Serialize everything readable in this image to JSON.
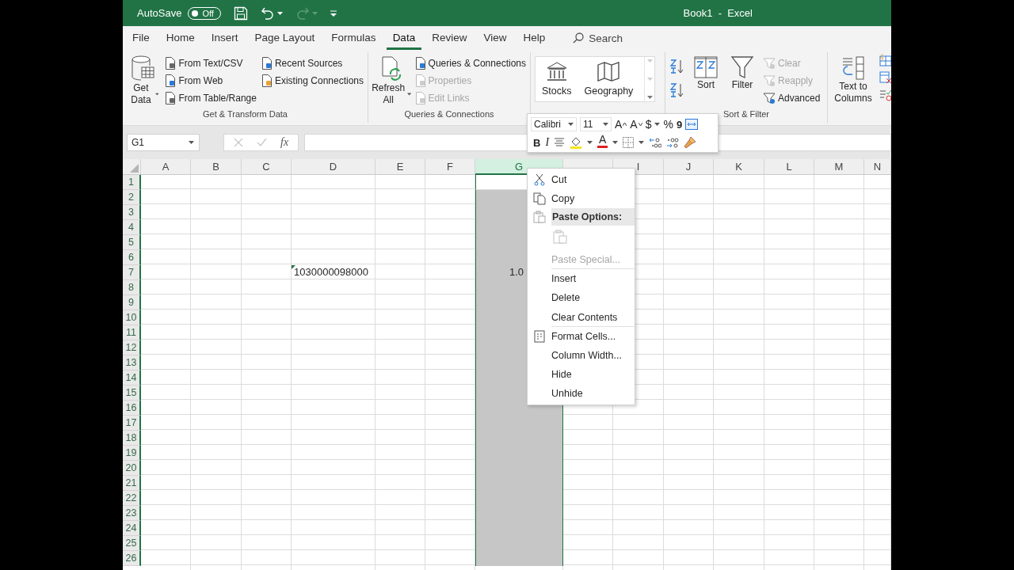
{
  "title_bar": {
    "autosave_label": "AutoSave",
    "autosave": {
      "on": false,
      "label": "Off"
    },
    "title": "Book1  -  Excel"
  },
  "menu_tabs": [
    {
      "label": "File",
      "selected": false
    },
    {
      "label": "Home",
      "selected": false
    },
    {
      "label": "Insert",
      "selected": false
    },
    {
      "label": "Page Layout",
      "selected": false
    },
    {
      "label": "Formulas",
      "selected": false
    },
    {
      "label": "Data",
      "selected": true
    },
    {
      "label": "Review",
      "selected": false
    },
    {
      "label": "View",
      "selected": false
    },
    {
      "label": "Help",
      "selected": false
    }
  ],
  "search": {
    "placeholder": "Search"
  },
  "ribbon": {
    "groups": [
      {
        "kind": "get-transform",
        "label": "Get & Transform Data",
        "large": [
          {
            "label": "Get Data",
            "disabled": false
          }
        ],
        "items": [
          {
            "label": "From Text/CSV",
            "disabled": false
          },
          {
            "label": "From Web",
            "disabled": false
          },
          {
            "label": "From Table/Range",
            "disabled": false
          },
          {
            "label": "Recent Sources",
            "disabled": false
          },
          {
            "label": "Existing Connections",
            "disabled": false
          }
        ]
      },
      {
        "kind": "queries",
        "label": "Queries & Connections",
        "large": [
          {
            "label": "Refresh All",
            "disabled": false
          }
        ],
        "items": [
          {
            "label": "Queries & Connections",
            "disabled": false
          },
          {
            "label": "Properties",
            "disabled": true
          },
          {
            "label": "Edit Links",
            "disabled": true
          }
        ]
      },
      {
        "kind": "data-types",
        "large": [
          {
            "label": "Stocks",
            "disabled": false
          },
          {
            "label": "Geography",
            "disabled": false
          }
        ]
      },
      {
        "kind": "sort-filter",
        "label": "Sort & Filter",
        "large": [
          {
            "label": "Sort",
            "disabled": false
          },
          {
            "label": "Filter",
            "disabled": false
          }
        ],
        "items": [
          {
            "label": "Clear",
            "disabled": true
          },
          {
            "label": "Reapply",
            "disabled": true
          },
          {
            "label": "Advanced",
            "disabled": false
          }
        ]
      },
      {
        "kind": "data-tools",
        "large": [
          {
            "label": "Text to Columns",
            "disabled": false
          }
        ]
      }
    ]
  },
  "mini_toolbar": {
    "font": "Calibri",
    "size": "11",
    "grow": "A",
    "shrink": "A",
    "currency": "$",
    "percent": "%",
    "comma": "9",
    "bold": "B",
    "italic": "I",
    "font_color": "A"
  },
  "formula_bar": {
    "name_box": "G1",
    "function_label": "fx"
  },
  "columns": [
    {
      "label": "A",
      "selected": false
    },
    {
      "label": "B",
      "selected": false
    },
    {
      "label": "C",
      "selected": false
    },
    {
      "label": "D",
      "selected": false
    },
    {
      "label": "E",
      "selected": false
    },
    {
      "label": "F",
      "selected": false
    },
    {
      "label": "G",
      "selected": true
    },
    {
      "selected": false
    },
    {
      "label": "I",
      "selected": false
    },
    {
      "label": "J",
      "selected": false
    },
    {
      "label": "K",
      "selected": false
    },
    {
      "label": "L",
      "selected": false
    },
    {
      "label": "M",
      "selected": false
    },
    {
      "label": "N",
      "selected": false
    }
  ],
  "rows": [
    {
      "header": "1"
    },
    {
      "header": "2"
    },
    {
      "header": "3"
    },
    {
      "header": "4"
    },
    {
      "header": "5"
    },
    {
      "header": "6"
    },
    {
      "header": "7",
      "cells": [
        null,
        null,
        null,
        {
          "text": "1030000098000",
          "kind": "text",
          "error_flag": true
        },
        null,
        null,
        {
          "text": "1.0",
          "kind": "number",
          "error_flag": false
        }
      ]
    },
    {
      "header": "8"
    },
    {
      "header": "9"
    },
    {
      "header": "10"
    },
    {
      "header": "11"
    },
    {
      "header": "12"
    },
    {
      "header": "13"
    },
    {
      "header": "14"
    },
    {
      "header": "15"
    },
    {
      "header": "16"
    },
    {
      "header": "17"
    },
    {
      "header": "18"
    },
    {
      "header": "19"
    },
    {
      "header": "20"
    },
    {
      "header": "21"
    },
    {
      "header": "22"
    },
    {
      "header": "23"
    },
    {
      "header": "24"
    },
    {
      "header": "25"
    },
    {
      "header": "26"
    }
  ],
  "context_menu": [
    {
      "kind": "cut",
      "label": "Cut",
      "disabled": false,
      "separator_after": false
    },
    {
      "kind": "copy",
      "label": "Copy",
      "disabled": false,
      "separator_after": false
    },
    {
      "kind": "header",
      "label": "Paste Options:",
      "separator_after": false
    },
    {
      "kind": "paste-option",
      "disabled": true,
      "separator_after": false
    },
    {
      "kind": "plain",
      "label": "Paste Special...",
      "disabled": true,
      "separator_after": true
    },
    {
      "kind": "plain",
      "label": "Insert",
      "disabled": false,
      "separator_after": false
    },
    {
      "kind": "plain",
      "label": "Delete",
      "disabled": false,
      "separator_after": false
    },
    {
      "kind": "plain",
      "label": "Clear Contents",
      "disabled": false,
      "separator_after": true
    },
    {
      "kind": "format",
      "label": "Format Cells...",
      "disabled": false,
      "separator_after": false
    },
    {
      "kind": "plain",
      "label": "Column Width...",
      "disabled": false,
      "separator_after": false
    },
    {
      "kind": "plain",
      "label": "Hide",
      "disabled": false,
      "separator_after": false
    },
    {
      "kind": "plain",
      "label": "Unhide",
      "disabled": false,
      "separator_after": false
    }
  ]
}
